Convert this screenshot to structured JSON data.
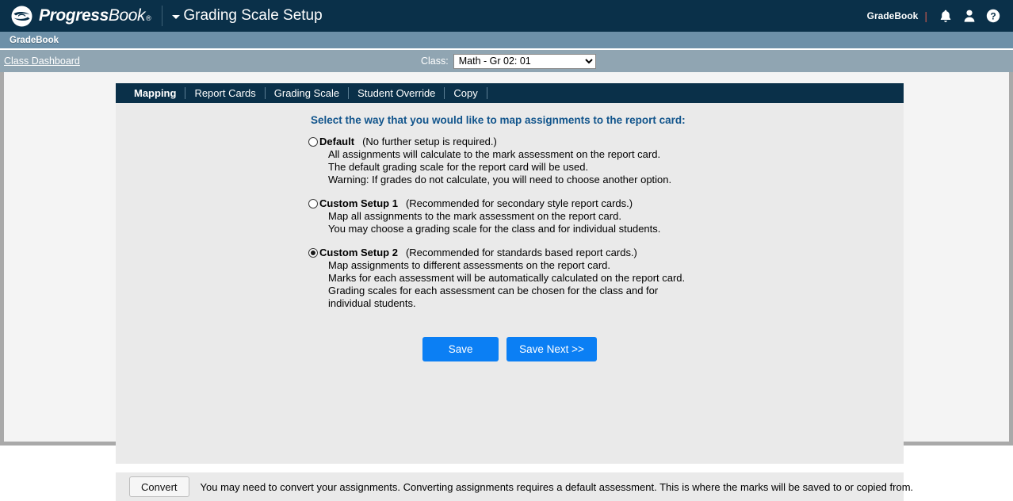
{
  "header": {
    "brand_primary": "Progress",
    "brand_secondary": "Book",
    "brand_tm": "®",
    "page_title": "Grading Scale Setup",
    "user_label": "GradeBook",
    "icons": {
      "bell": "notifications-icon",
      "user": "user-account-icon",
      "help": "help-icon"
    },
    "colors": {
      "bar": "#0a3049",
      "pipe": "#cf5b4f"
    }
  },
  "module_bar": {
    "label": "GradeBook",
    "color": "#6d90a8"
  },
  "context_bar": {
    "breadcrumb": "Class Dashboard",
    "class_label": "Class:",
    "class_selected": "Math - Gr 02: 01",
    "class_options": [
      "Math - Gr 02: 01"
    ],
    "color": "#90a5b2"
  },
  "tabs": [
    {
      "label": "Mapping",
      "active": true
    },
    {
      "label": "Report Cards",
      "active": false
    },
    {
      "label": "Grading Scale",
      "active": false
    },
    {
      "label": "Student Override",
      "active": false
    },
    {
      "label": "Copy",
      "active": false
    }
  ],
  "panel": {
    "heading": "Select the way that you would like to map assignments to the report card:",
    "heading_color": "#12558c",
    "options": [
      {
        "id": "default",
        "title": "Default",
        "note": "(No further setup is required.)",
        "selected": false,
        "lines": [
          "All assignments will calculate to the mark assessment on the report card.",
          "The default grading scale for the report card will be used.",
          "Warning: If grades do not calculate, you will need to choose another option."
        ]
      },
      {
        "id": "custom-setup-1",
        "title": "Custom Setup 1",
        "note": "(Recommended for secondary style report cards.)",
        "selected": false,
        "lines": [
          "Map all assignments to the mark assessment on the report card.",
          "You may choose a grading scale for the class and for individual students."
        ]
      },
      {
        "id": "custom-setup-2",
        "title": "Custom Setup 2",
        "note": "(Recommended for standards based report cards.)",
        "selected": true,
        "lines": [
          "Map assignments to different assessments on the report card.",
          "Marks for each assessment will be automatically calculated on the report card.",
          "Grading scales for each assessment can be chosen for the class and for",
          "individual students."
        ]
      }
    ],
    "save_label": "Save",
    "save_next_label": "Save Next >>",
    "button_color": "#0b7ff4"
  },
  "convert_bar": {
    "button_label": "Convert",
    "text": "You may need to convert your assignments. Converting assignments requires a default assessment. This is where the marks will be saved to or copied from."
  }
}
